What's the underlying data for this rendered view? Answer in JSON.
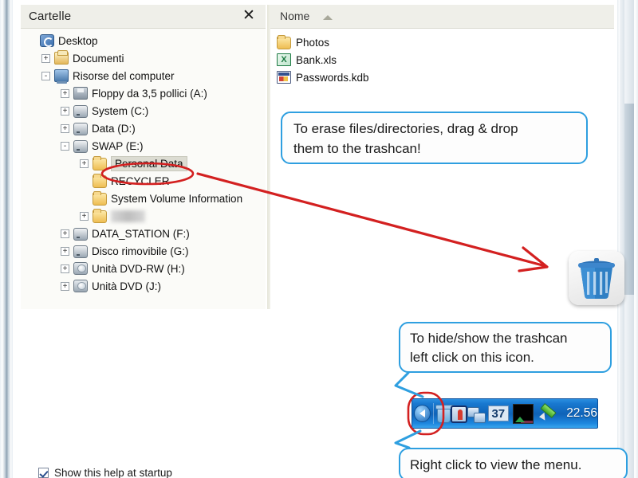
{
  "window": {
    "tree_panel_title": "Cartelle",
    "close_icon": "close-x-icon",
    "list_panel_title": "Nome",
    "sort_caret": "sort-ascending-caret-icon"
  },
  "tree": {
    "items": [
      {
        "label": "Desktop",
        "indent": 0,
        "expander": "",
        "icon": "desktop-icon",
        "selected": false,
        "blurred": false
      },
      {
        "label": "Documenti",
        "indent": 1,
        "expander": "+",
        "icon": "documents-folder-icon",
        "selected": false,
        "blurred": false
      },
      {
        "label": "Risorse del computer",
        "indent": 1,
        "expander": "-",
        "icon": "my-computer-icon",
        "selected": false,
        "blurred": false
      },
      {
        "label": "Floppy da 3,5 pollici (A:)",
        "indent": 2,
        "expander": "+",
        "icon": "floppy-drive-icon",
        "selected": false,
        "blurred": false
      },
      {
        "label": "System (C:)",
        "indent": 2,
        "expander": "+",
        "icon": "hard-drive-icon",
        "selected": false,
        "blurred": false
      },
      {
        "label": "Data (D:)",
        "indent": 2,
        "expander": "+",
        "icon": "hard-drive-icon",
        "selected": false,
        "blurred": false
      },
      {
        "label": "SWAP (E:)",
        "indent": 2,
        "expander": "-",
        "icon": "hard-drive-icon",
        "selected": false,
        "blurred": false
      },
      {
        "label": "Personal Data",
        "indent": 3,
        "expander": "+",
        "icon": "folder-icon",
        "selected": true,
        "blurred": false
      },
      {
        "label": "RECYCLER",
        "indent": 3,
        "expander": "",
        "icon": "folder-icon",
        "selected": false,
        "blurred": false
      },
      {
        "label": "System Volume Information",
        "indent": 3,
        "expander": "",
        "icon": "folder-icon",
        "selected": false,
        "blurred": false
      },
      {
        "label": "         ",
        "indent": 3,
        "expander": "+",
        "icon": "folder-icon",
        "selected": false,
        "blurred": true
      },
      {
        "label": "DATA_STATION (F:)",
        "indent": 2,
        "expander": "+",
        "icon": "hard-drive-icon",
        "selected": false,
        "blurred": false
      },
      {
        "label": "Disco rimovibile (G:)",
        "indent": 2,
        "expander": "+",
        "icon": "hard-drive-icon",
        "selected": false,
        "blurred": false
      },
      {
        "label": "Unità DVD-RW (H:)",
        "indent": 2,
        "expander": "+",
        "icon": "dvd-drive-icon",
        "selected": false,
        "blurred": false
      },
      {
        "label": "Unità DVD (J:)",
        "indent": 2,
        "expander": "+",
        "icon": "dvd-drive-icon",
        "selected": false,
        "blurred": false
      }
    ]
  },
  "file_list": {
    "items": [
      {
        "label": "Photos",
        "icon": "folder-icon"
      },
      {
        "label": "Bank.xls",
        "icon": "excel-file-icon"
      },
      {
        "label": "Passwords.kdb",
        "icon": "keepass-file-icon"
      }
    ]
  },
  "callouts": {
    "erase": "To erase files/directories, drag & drop\nthem to the trashcan!",
    "hide_show": "To hide/show the trashcan\nleft click on this icon.",
    "right_click": "Right click to view the menu."
  },
  "trashcan": {
    "icon": "trashcan-icon"
  },
  "tray": {
    "items": [
      {
        "icon": "show-hidden-icons-arrow-icon",
        "label": ""
      },
      {
        "icon": "trashcan-tray-icon",
        "label": ""
      },
      {
        "icon": "security-lock-icon",
        "label": ""
      },
      {
        "icon": "network-connection-icon",
        "label": ""
      },
      {
        "icon": "counter-badge-icon",
        "label": "37"
      },
      {
        "icon": "black-screen-icon",
        "label": ""
      },
      {
        "icon": "pencil-icon",
        "label": ""
      }
    ],
    "clock": "22.56"
  },
  "footer": {
    "show_at_startup_label": "Show this help at startup",
    "show_at_startup_checked": true
  },
  "colors": {
    "callout_border": "#2e9fe0",
    "annotation_red": "#d32020",
    "tray_blue": "#1878cf",
    "selection_grey": "#dcdcd2"
  }
}
